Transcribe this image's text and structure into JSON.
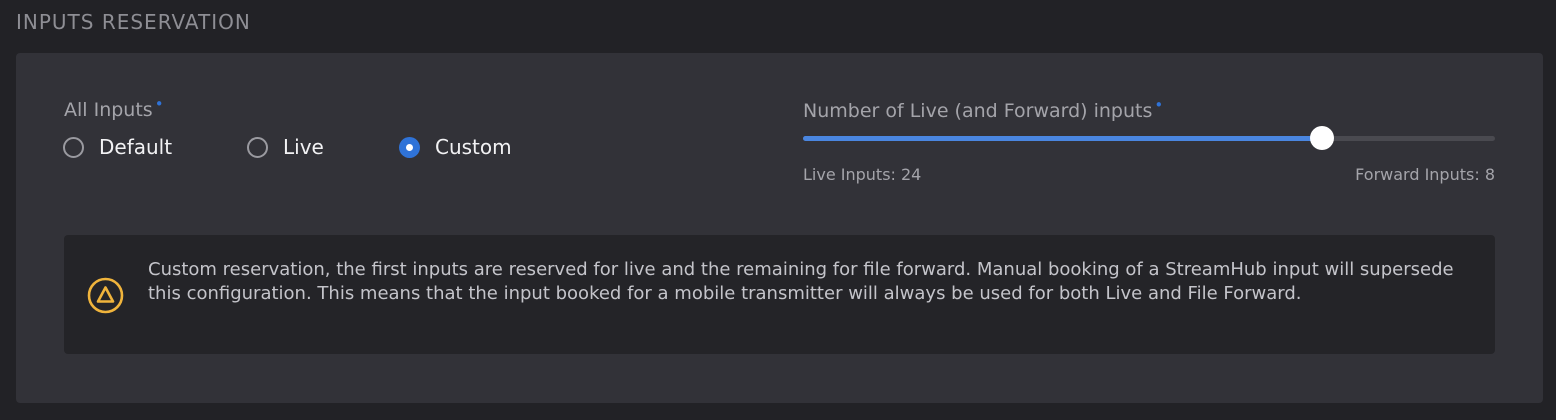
{
  "section": {
    "title": "INPUTS RESERVATION"
  },
  "all_inputs": {
    "label": "All Inputs",
    "required_mark": "•",
    "options": [
      {
        "label": "Default",
        "checked": false
      },
      {
        "label": "Live",
        "checked": false
      },
      {
        "label": "Custom",
        "checked": true
      }
    ]
  },
  "live_slider": {
    "label": "Number of Live (and Forward) inputs",
    "required_mark": "•",
    "live_inputs_text": "Live Inputs: 24",
    "forward_inputs_text": "Forward Inputs: 8",
    "live_inputs": 24,
    "forward_inputs": 8,
    "value_fraction": 0.75
  },
  "alert": {
    "icon": "warning-icon",
    "text": "Custom reservation, the first inputs are reserved for live and the remaining for file forward. Manual booking of a StreamHub input will supersede this configuration. This means that the input booked for a mobile transmitter will always be used for both Live and File Forward."
  },
  "colors": {
    "accent": "#2f73d8",
    "slider_fill": "#4a86e0",
    "warning": "#f0b43c"
  }
}
